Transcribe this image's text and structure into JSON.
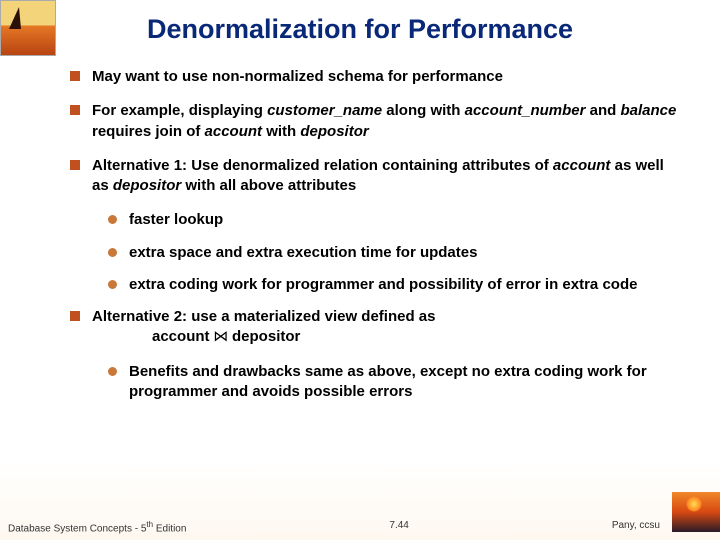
{
  "title": "Denormalization for Performance",
  "bullets": {
    "b1": "May want to use non-normalized schema for performance",
    "b2_pre": "For example, displaying ",
    "b2_i1": "customer_name",
    "b2_mid1": " along with ",
    "b2_i2": "account_number",
    "b2_mid2": " and ",
    "b2_i3": "balance",
    "b2_mid3": " requires join of ",
    "b2_i4": "account",
    "b2_mid4": " with ",
    "b2_i5": "depositor",
    "b3_pre": "Alternative 1:  Use denormalized relation containing attributes of ",
    "b3_i1": "account",
    "b3_mid1": " as well as ",
    "b3_i2": "depositor",
    "b3_post": " with all above attributes",
    "s1": "faster lookup",
    "s2": "extra space and extra execution time for updates",
    "s3": "extra coding work for programmer and possibility of error in extra code",
    "b4_line1": "Alternative 2: use a materialized view defined as",
    "b4_acct": "account",
    "b4_join": " ⋈ ",
    "b4_dep": "depositor",
    "s4": "Benefits and drawbacks same as above, except no extra coding work for programmer and avoids possible errors"
  },
  "footer": {
    "left_a": "Database System Concepts - 5",
    "left_b": " Edition",
    "left_sup": "th",
    "center": "7.44",
    "right": "Pany, ccsu"
  }
}
